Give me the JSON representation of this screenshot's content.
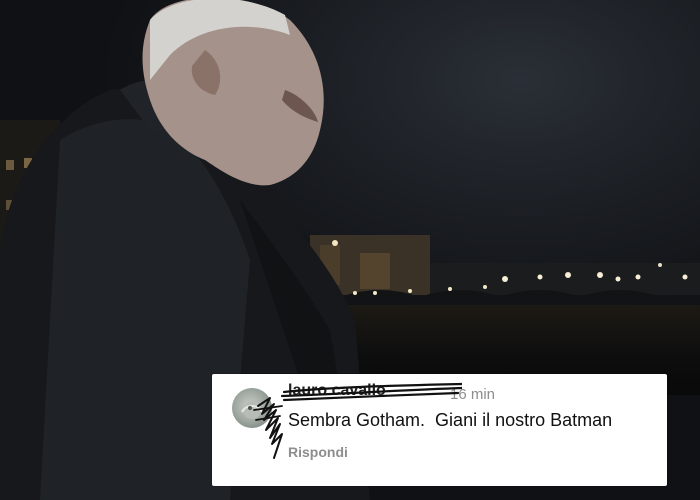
{
  "comment": {
    "username": "lauro cavallo",
    "timestamp": "16 min",
    "text": "Sembra Gotham.  Giani il nostro Batman",
    "reply_label": "Rispondi"
  },
  "colors": {
    "card_background": "#ffffff",
    "text_primary": "#111111",
    "text_secondary": "#8e8e8e",
    "scribble": "#111111"
  }
}
